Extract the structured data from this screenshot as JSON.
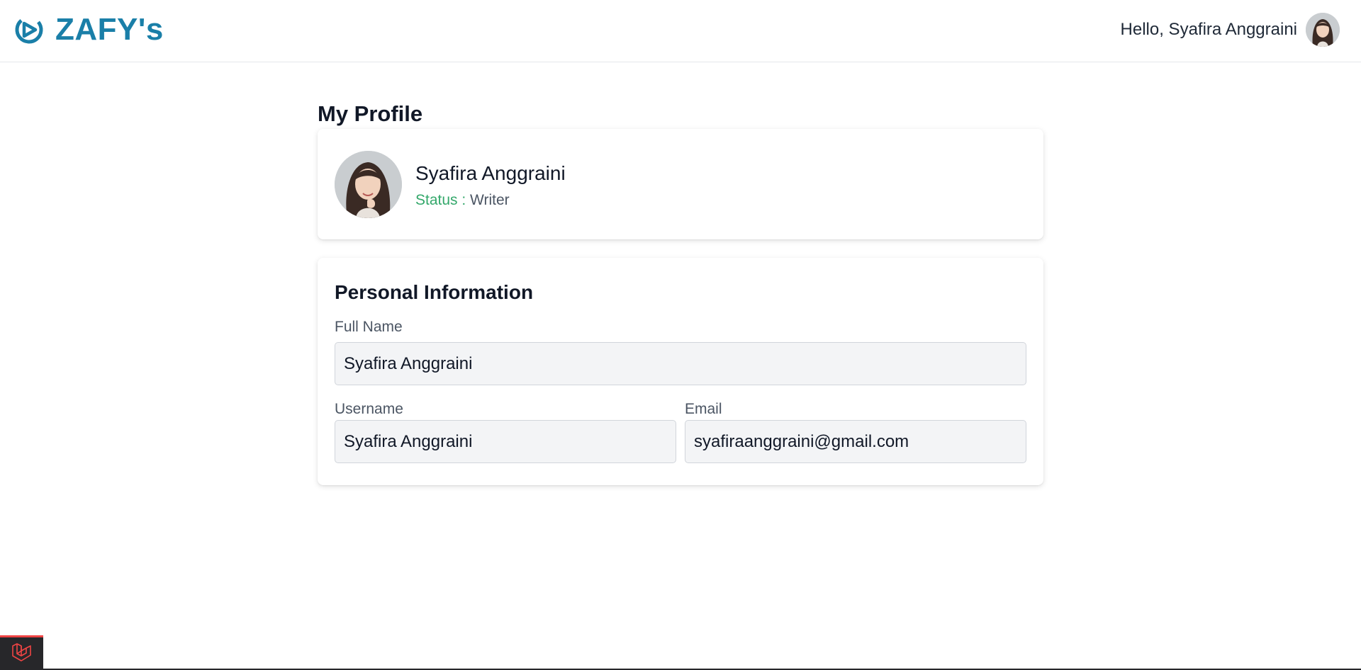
{
  "header": {
    "brand_name": "ZAFY's",
    "brand_icon": "zafys-logo-icon",
    "brand_color": "#1a7fa8",
    "greeting": "Hello, Syafira Anggraini",
    "avatar_icon": "user-avatar"
  },
  "page": {
    "title": "My Profile"
  },
  "profile_card": {
    "name": "Syafira Anggraini",
    "status_label": "Status :",
    "status_value": "Writer",
    "status_label_color": "#34a86b"
  },
  "personal_info": {
    "title": "Personal Information",
    "full_name": {
      "label": "Full Name",
      "value": "Syafira Anggraini"
    },
    "username": {
      "label": "Username",
      "value": "Syafira Anggraini"
    },
    "email": {
      "label": "Email",
      "value": "syafiraanggraini@gmail.com"
    }
  },
  "debug_badge": {
    "icon": "laravel-logo-icon"
  }
}
